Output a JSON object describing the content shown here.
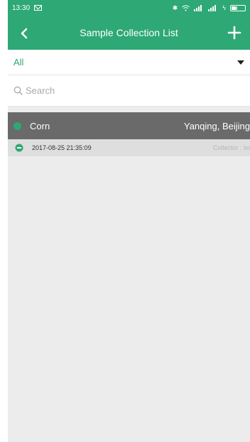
{
  "status_bar": {
    "time": "13:30",
    "battery_level": "50"
  },
  "toolbar": {
    "title": "Sample Collection List"
  },
  "filter": {
    "selected": "All"
  },
  "search": {
    "placeholder": "Search"
  },
  "groups": [
    {
      "crop": "Corn",
      "location": "Yanqing, Beijing",
      "records": [
        {
          "datetime": "2017-08-25 21:35:09",
          "collector": "Collector : lio"
        }
      ]
    }
  ],
  "colors": {
    "accent": "#2ea875",
    "group_header": "#6a6a6a",
    "record_row": "#dedede",
    "background": "#ececec"
  }
}
